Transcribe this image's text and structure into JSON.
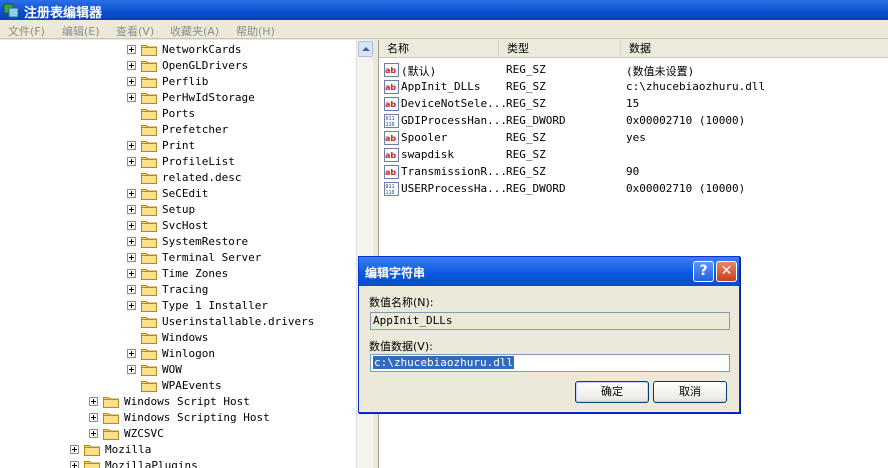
{
  "window": {
    "title": "注册表编辑器"
  },
  "menu": [
    "文件(F)",
    "编辑(E)",
    "查看(V)",
    "收藏夹(A)",
    "帮助(H)"
  ],
  "tree": [
    {
      "label": "NetworkCards",
      "expander": true
    },
    {
      "label": "OpenGLDrivers",
      "expander": true
    },
    {
      "label": "Perflib",
      "expander": true
    },
    {
      "label": "PerHwIdStorage",
      "expander": true
    },
    {
      "label": "Ports",
      "expander": false
    },
    {
      "label": "Prefetcher",
      "expander": false
    },
    {
      "label": "Print",
      "expander": true
    },
    {
      "label": "ProfileList",
      "expander": true
    },
    {
      "label": "related.desc",
      "expander": false
    },
    {
      "label": "SeCEdit",
      "expander": true
    },
    {
      "label": "Setup",
      "expander": true
    },
    {
      "label": "SvcHost",
      "expander": true
    },
    {
      "label": "SystemRestore",
      "expander": true
    },
    {
      "label": "Terminal Server",
      "expander": true
    },
    {
      "label": "Time Zones",
      "expander": true
    },
    {
      "label": "Tracing",
      "expander": true
    },
    {
      "label": "Type 1 Installer",
      "expander": true
    },
    {
      "label": "Userinstallable.drivers",
      "expander": false
    },
    {
      "label": "Windows",
      "expander": false
    },
    {
      "label": "Winlogon",
      "expander": true
    },
    {
      "label": "WOW",
      "expander": true
    },
    {
      "label": "WPAEvents",
      "expander": false
    },
    {
      "label": "Windows Script Host",
      "expander": true
    },
    {
      "label": "Windows Scripting Host",
      "expander": true
    },
    {
      "label": "WZCSVC",
      "expander": true
    },
    {
      "label": "Mozilla",
      "expander": true
    },
    {
      "label": "MozillaPlugins",
      "expander": true
    }
  ],
  "columns": {
    "name": "名称",
    "type": "类型",
    "data": "数据"
  },
  "values": [
    {
      "icon": "string-value-icon",
      "name": "(默认)",
      "type": "REG_SZ",
      "data": "(数值未设置)"
    },
    {
      "icon": "string-value-icon",
      "name": "AppInit_DLLs",
      "type": "REG_SZ",
      "data": "c:\\zhucebiaozhuru.dll"
    },
    {
      "icon": "string-value-icon",
      "name": "DeviceNotSele...",
      "type": "REG_SZ",
      "data": "15"
    },
    {
      "icon": "dword-value-icon",
      "name": "GDIProcessHan...",
      "type": "REG_DWORD",
      "data": "0x00002710 (10000)"
    },
    {
      "icon": "string-value-icon",
      "name": "Spooler",
      "type": "REG_SZ",
      "data": "yes"
    },
    {
      "icon": "string-value-icon",
      "name": "swapdisk",
      "type": "REG_SZ",
      "data": ""
    },
    {
      "icon": "string-value-icon",
      "name": "TransmissionR...",
      "type": "REG_SZ",
      "data": "90"
    },
    {
      "icon": "dword-value-icon",
      "name": "USERProcessHa...",
      "type": "REG_DWORD",
      "data": "0x00002710 (10000)"
    }
  ],
  "dialog": {
    "title": "编辑字符串",
    "help": "?",
    "close": "✕",
    "name_label": "数值名称(N):",
    "name_value": "AppInit_DLLs",
    "data_label": "数值数据(V):",
    "data_value": "c:\\zhucebiaozhuru.dll",
    "ok": "确定",
    "cancel": "取消"
  },
  "colors": {
    "titlebar": "#0a4fd0",
    "selection": "#316ac5",
    "folder": "#f6d365"
  }
}
